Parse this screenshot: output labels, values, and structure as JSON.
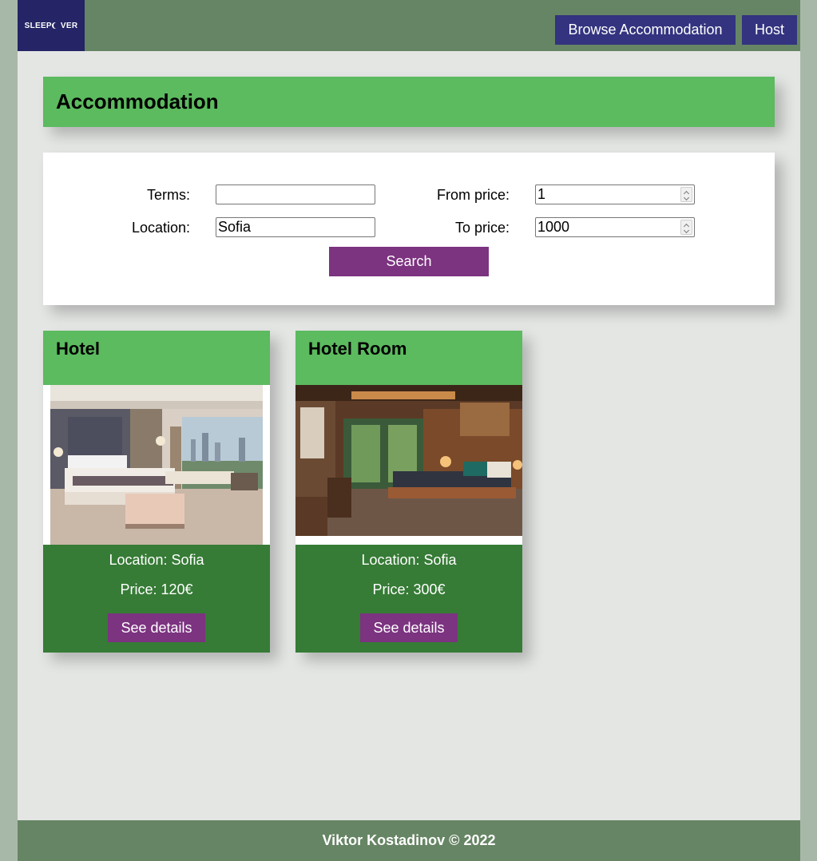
{
  "header": {
    "logo_text": "SLEEPOVER",
    "logo_left": "SLEEP",
    "logo_right": "VER",
    "nav": {
      "browse_label": "Browse Accommodation",
      "host_label": "Host"
    }
  },
  "page": {
    "title": "Accommodation"
  },
  "search": {
    "terms_label": "Terms:",
    "terms_value": "",
    "location_label": "Location:",
    "location_value": "Sofia",
    "from_price_label": "From price:",
    "from_price_value": "1",
    "to_price_label": "To price:",
    "to_price_value": "1000",
    "button_label": "Search"
  },
  "listings": [
    {
      "title": "Hotel",
      "location": "Location: Sofia",
      "price": "Price: 120€",
      "button_label": "See details"
    },
    {
      "title": "Hotel Room",
      "location": "Location: Sofia",
      "price": "Price: 300€",
      "button_label": "See details"
    }
  ],
  "footer": {
    "text": "Viktor Kostadinov © 2022"
  },
  "colors": {
    "navbar": "#668564",
    "logo_bg": "#242466",
    "nav_button": "#333380",
    "accent_green": "#5cba5f",
    "card_footer": "#367b36",
    "purple_button": "#7c3380",
    "page_bg": "#e4e6e4"
  }
}
